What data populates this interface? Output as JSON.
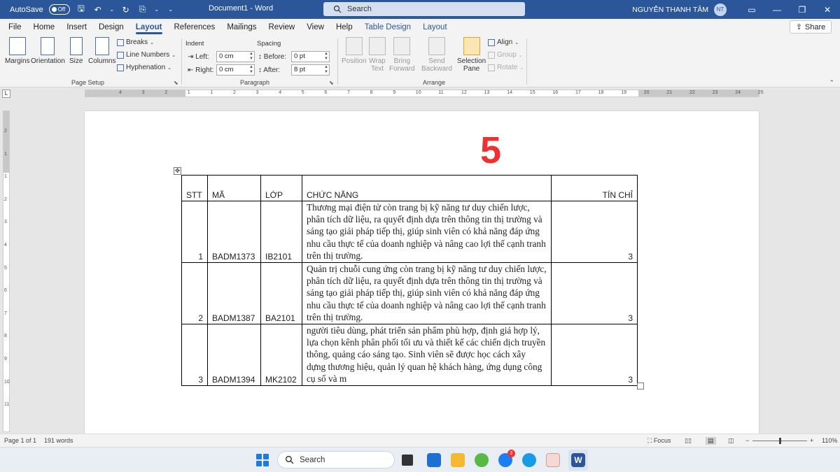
{
  "titlebar": {
    "autosave_label": "AutoSave",
    "autosave_state": "Off",
    "doc_title": "Document1  -  Word",
    "search_placeholder": "Search",
    "user_name": "NGUYỄN THANH TÂM",
    "avatar_initials": "NT",
    "accent": "#2b579a"
  },
  "tabs": [
    "File",
    "Home",
    "Insert",
    "Design",
    "Layout",
    "References",
    "Mailings",
    "Review",
    "View",
    "Help",
    "Table Design",
    "Layout"
  ],
  "share_label": "Share",
  "ribbon": {
    "page_setup": {
      "margins": "Margins",
      "orientation": "Orientation",
      "size": "Size",
      "columns": "Columns",
      "breaks": "Breaks",
      "line_numbers": "Line Numbers",
      "hyphenation": "Hyphenation",
      "label": "Page Setup"
    },
    "paragraph": {
      "indent_title": "Indent",
      "spacing_title": "Spacing",
      "left_label": "Left:",
      "left_value": "0 cm",
      "right_label": "Right:",
      "right_value": "0 cm",
      "before_label": "Before:",
      "before_value": "0 pt",
      "after_label": "After:",
      "after_value": "8 pt",
      "label": "Paragraph"
    },
    "arrange": {
      "position": "Position",
      "wrap_text_1": "Wrap",
      "wrap_text_2": "Text",
      "bring_forward_1": "Bring",
      "bring_forward_2": "Forward",
      "send_backward_1": "Send",
      "send_backward_2": "Backward",
      "selection_pane_1": "Selection",
      "selection_pane_2": "Pane",
      "align": "Align",
      "group": "Group",
      "rotate": "Rotate",
      "label": "Arrange"
    }
  },
  "hruler_numbers": [
    "4",
    "3",
    "2",
    "1",
    "1",
    "2",
    "3",
    "4",
    "5",
    "6",
    "7",
    "8",
    "9",
    "10",
    "11",
    "12",
    "13",
    "14",
    "15",
    "16",
    "17",
    "18",
    "19",
    "20",
    "21",
    "22",
    "23",
    "24",
    "25"
  ],
  "vruler_numbers": [
    "2",
    "1",
    "1",
    "2",
    "3",
    "4",
    "5",
    "6",
    "7",
    "8",
    "9",
    "10",
    "11"
  ],
  "document": {
    "big_number": "5",
    "table": {
      "headers": [
        "STT",
        "MÃ",
        "LỚP",
        "CHỨC NĂNG",
        "TÍN CHỈ"
      ],
      "rows": [
        {
          "stt": "1",
          "ma": "BADM1373",
          "lop": "IB2101",
          "desc": "Thương mại điện tử còn trang bị kỹ năng tư duy chiến lược, phân tích dữ liệu, ra quyết định dựa trên thông tin thị trường và sáng tạo giải pháp tiếp thị, giúp sinh viên có khả năng đáp ứng nhu cầu thực tế của doanh nghiệp và nâng cao lợi thế cạnh tranh trên thị trường.",
          "tin_chi": "3"
        },
        {
          "stt": "2",
          "ma": "BADM1387",
          "lop": "BA2101",
          "desc": "Quản trị chuỗi cung ứng còn trang bị kỹ năng tư duy chiến lược, phân tích dữ liệu, ra quyết định dựa trên thông tin thị trường và sáng tạo giải pháp tiếp thị, giúp sinh viên có khả năng đáp ứng nhu cầu thực tế của doanh nghiệp và nâng cao lợi thế cạnh tranh trên thị trường.",
          "tin_chi": "3"
        },
        {
          "stt": "3",
          "ma": "BADM1394",
          "lop": "MK2102",
          "desc": "người tiêu dùng, phát triển sản phẩm phù hợp, định giá hợp lý, lựa chọn kênh phân phối tối ưu và thiết kế các chiến dịch truyền thông, quảng cáo sáng tạo. Sinh viên sẽ được học cách xây dựng thương hiệu, quản lý quan hệ khách hàng, ứng dụng công cụ số và m",
          "tin_chi": "3"
        }
      ]
    }
  },
  "statusbar": {
    "page": "Page 1 of 1",
    "words": "191 words",
    "focus": "Focus",
    "zoom": "110%"
  },
  "taskbar": {
    "search": "Search",
    "zalo_badge": "2"
  }
}
